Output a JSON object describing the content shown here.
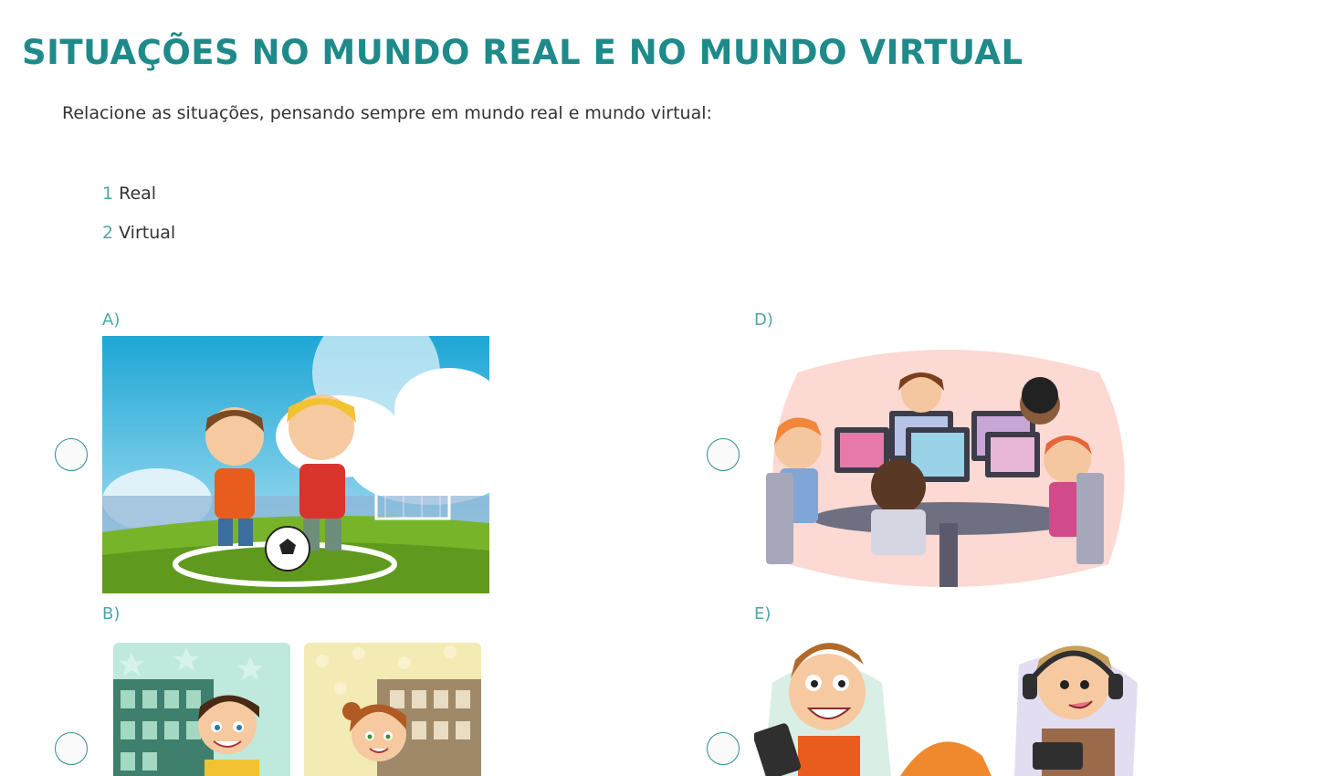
{
  "page": {
    "title": "SITUAÇÕES NO MUNDO REAL E NO MUNDO VIRTUAL",
    "instruction": "Relacione as situações, pensando sempre em mundo real e mundo virtual:"
  },
  "legend": [
    {
      "number": "1",
      "text": "Real"
    },
    {
      "number": "2",
      "text": "Virtual"
    }
  ],
  "items": [
    {
      "letter": "A)",
      "image": "kids-playing-soccer-illustration",
      "selected": false
    },
    {
      "letter": "B)",
      "image": "boy-and-girl-at-windows-illustration",
      "selected": false
    },
    {
      "letter": "D)",
      "image": "kids-at-computers-illustration",
      "selected": false
    },
    {
      "letter": "E)",
      "image": "boys-with-tablets-illustration",
      "selected": false
    }
  ],
  "colors": {
    "title": "#1e8a8a",
    "accent": "#4aa7a7",
    "radio_border": "#2f8f8f"
  }
}
